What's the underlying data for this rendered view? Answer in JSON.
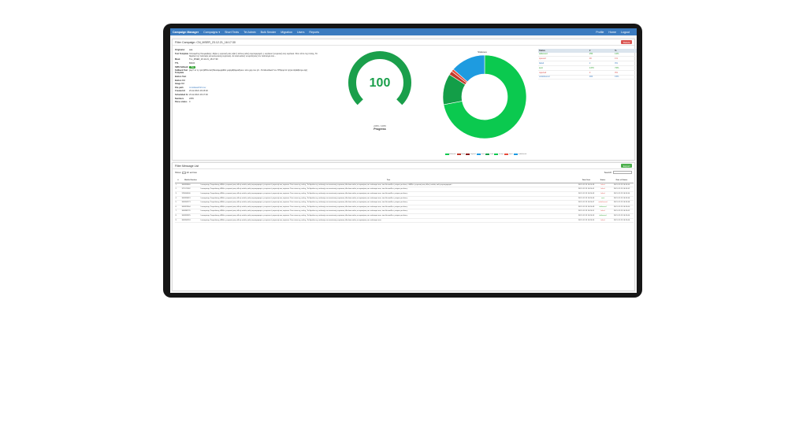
{
  "nav": {
    "brand": "Campaign Manager",
    "items": [
      "Campaigns ▾",
      "Short Texts",
      "Tel Admin",
      "Bulk Sender",
      "Migration",
      "Users",
      "Reports"
    ],
    "right_items": [
      "Profile",
      "Home",
      "Logout"
    ]
  },
  "campaign": {
    "title": "Filter Campaign: CN_MSER_23.12.21_16:17:30",
    "delete_label": "Delete",
    "details": [
      {
        "label": "Originator",
        "value": "aaa",
        "type": "text"
      },
      {
        "label": "Text Template",
        "value": "Ιπποκράτης Σουμελάκης: Αξίζει η ευγενική σας αξία ή απλώς καλή συμπεριφορά, η ευγένεια ή ευγενική σας ευγένεια. Στον τόπο της πόλης, Τα θεμέλια της πολιτικής και κοινωνικής ευγένειας. Αν είσαι καλός να κρατήσεις τον πολιτισμό σου...",
        "type": "text"
      },
      {
        "label": "Mask",
        "value": "TLL_MSER_23.12.21_16:17:30",
        "type": "text"
      },
      {
        "label": "TTL",
        "value": "86400",
        "type": "text"
      },
      {
        "label": "SMS Fallback",
        "value": "Yes",
        "type": "badge"
      },
      {
        "label": "Fallback Text Template",
        "value": "[αιμΤ τα τη τρτιτ|ΜΤανπατ|Πανααμφ|αΜιπ με|αμΦ|Ιαμαδ|ναι ο απο χαρ του ηΣ...Τα Μοναδικά Γνώ ΠΠτ|εγά Ω τητ|αν Ω|αΜ|ατρο α|σ]",
        "type": "text"
      },
      {
        "label": "Button Text",
        "value": "",
        "type": "text"
      },
      {
        "label": "Button Url",
        "value": "",
        "type": "text"
      },
      {
        "label": "Image Url",
        "value": "",
        "type": "text"
      },
      {
        "label": "File path",
        "value": "/mnt/data/CSV.csv",
        "type": "link"
      },
      {
        "label": "Created At",
        "value": "23.12.2021 16:15:02",
        "type": "text"
      },
      {
        "label": "Scheduled At",
        "value": "23.12.2021 16:17:30",
        "type": "text"
      },
      {
        "label": "Numbers",
        "value": "2055",
        "type": "text"
      },
      {
        "label": "Parse status",
        "value": "0",
        "type": "text"
      }
    ],
    "gauge": {
      "value": "100",
      "fraction": 1,
      "sub": "2055 / 2055",
      "caption": "Progress",
      "color": "#1a9f4b"
    },
    "donut_title": "Statuses",
    "donut": [
      {
        "name": "delivered",
        "value": 0.72,
        "color": "#0bc94f"
      },
      {
        "name": "queued",
        "value": 0.12,
        "color": "#139e48"
      },
      {
        "name": "failed",
        "value": 0.015,
        "color": "#c0392b"
      },
      {
        "name": "sent",
        "value": 0.01,
        "color": "#e74c3c"
      },
      {
        "name": "undelivered",
        "value": 0.135,
        "color": "#1e9be0"
      }
    ],
    "legend": [
      {
        "name": "delivered",
        "color": "#0bc94f"
      },
      {
        "name": "failed",
        "color": "#c0392b"
      },
      {
        "name": "expired",
        "color": "#8b1a1a"
      },
      {
        "name": "seen",
        "color": "#1e9be0"
      },
      {
        "name": "read",
        "color": "#139e48"
      },
      {
        "name": "accept",
        "color": "#0bc94f"
      },
      {
        "name": "reject",
        "color": "#e74c3c"
      },
      {
        "name": "undelivered",
        "color": "#1e9be0"
      }
    ],
    "status_table": {
      "headers": [
        "Status",
        "#",
        "%"
      ],
      "rows": [
        {
          "status": "delivered",
          "count": "250",
          "pct": "12%",
          "color": "#2ca02c"
        },
        {
          "status": "queued",
          "count": "30",
          "pct": "1%",
          "color": "#d9534f"
        },
        {
          "status": "failed",
          "count": "2",
          "pct": "0%",
          "color": "#3b7bbf"
        },
        {
          "status": "sent",
          "count": "1470",
          "pct": "72%",
          "color": "#2ca02c"
        },
        {
          "status": "rejected",
          "count": "3",
          "pct": "0%",
          "color": "#d9534f"
        },
        {
          "status": "undelivered",
          "count": "300",
          "pct": "15%",
          "color": "#3b7bbf"
        }
      ]
    }
  },
  "messages": {
    "title": "Filter Message List",
    "export_label": "Export",
    "show_label": "Show",
    "show_value": "10",
    "entries_label": "entries",
    "search_label": "Search:",
    "headers": [
      "#",
      "Mobile Number",
      "Text",
      "Date Sent",
      "Status",
      "Date of Status"
    ],
    "rows": [
      {
        "idx": "1",
        "number": "306993940",
        "text": "Ιπποκράτης Σουμελάκης: Αξίζει η ευγενική σας αξία ή απλώς καλή συμπεριφορά, η ευγένεια ή ευγενική σας ευγένεια. Στον τόπο της πόλης, Τα θεμέλια της πολιτικής και κοινωνικής ευγένειας. Αν είσαι καλός να κρατήσεις τον πολιτισμό σου, έτσι θα ανοίξει η πόρτα για όλους: «Αξίζει η ευγενική σας αξία ή απλώς καλή συμπεριφορά».",
        "date": "2021-12-23 16:24:39",
        "status": "failed",
        "status_color": "#d9534f",
        "date_status": "2021-12-23 16:24:50"
      },
      {
        "idx": "2",
        "number": "377071262",
        "text": "Ιπποκράτης Σουμελάκης: Αξίζει η ευγενική σας αξία ή απλώς καλή συμπεριφορά, η ευγένεια ή ευγενική σας ευγένεια. Στον τόπο της πόλης, Τα θεμέλια της πολιτικής και κοινωνικής ευγένειας. Αν είσαι καλός να κρατήσεις τον πολιτισμό σου, έτσι θα ανοίξει η πόρτα για όλους.",
        "date": "2021-12-23 16:24:41",
        "status": "failed",
        "status_color": "#d9534f",
        "date_status": "2021-12-23 16:24:52"
      },
      {
        "idx": "3",
        "number": "378094400",
        "text": "Ιπποκράτης Σουμελάκης: Αξίζει η ευγενική σας αξία ή απλώς καλή συμπεριφορά, η ευγένεια ή ευγενική σας ευγένεια. Στον τόπο της πόλης, Τα θεμέλια της πολιτικής και κοινωνικής ευγένειας. Αν είσαι καλός να κρατήσεις τον πολιτισμό σου, έτσι θα ανοίξει η πόρτα για όλους.",
        "date": "2021-12-23 16:24:43",
        "status": "failed",
        "status_color": "#d9534f",
        "date_status": "2021-12-23 16:24:54"
      },
      {
        "idx": "4",
        "number": "306993619",
        "text": "Ιπποκράτης Σουμελάκης: Αξίζει η ευγενική σας αξία ή απλώς καλή συμπεριφορά, η ευγένεια ή ευγενική σας ευγένεια. Στον τόπο της πόλης, Τα θεμέλια της πολιτικής και κοινωνικής ευγένειας. Αν είσαι καλός να κρατήσεις τον πολιτισμό σου, έτσι θα ανοίξει η πόρτα για όλους.",
        "date": "2021-12-23 16:24:45",
        "status": "sent",
        "status_color": "#2ca02c",
        "date_status": "2021-12-23 16:24:56"
      },
      {
        "idx": "5",
        "number": "306994273",
        "text": "Ιπποκράτης Σουμελάκης: Αξίζει η ευγενική σας αξία ή απλώς καλή συμπεριφορά, η ευγένεια ή ευγενική σας ευγένεια. Στον τόπο της πόλης, Τα θεμέλια της πολιτικής και κοινωνικής ευγένειας. Αν είσαι καλός να κρατήσεις τον πολιτισμό σου, έτσι θα ανοίξει η πόρτα για όλους.",
        "date": "2021-12-23 16:24:47",
        "status": "undelivered",
        "status_color": "#d9534f",
        "date_status": "2021-12-23 16:24:58"
      },
      {
        "idx": "6",
        "number": "306997804",
        "text": "Ιπποκράτης Σουμελάκης: Αξίζει η ευγενική σας αξία ή απλώς καλή συμπεριφορά, η ευγένεια ή ευγενική σας ευγένεια. Στον τόπο της πόλης, Τα θεμέλια της πολιτικής και κοινωνικής ευγένειας. Αν είσαι καλός να κρατήσεις τον πολιτισμό σου, έτσι θα ανοίξει η πόρτα για όλους.",
        "date": "2021-12-23 16:24:49",
        "status": "delivered",
        "status_color": "#2ca02c",
        "date_status": "2021-12-23 16:25:00"
      },
      {
        "idx": "7",
        "number": "306998776",
        "text": "Ιπποκράτης Σουμελάκης: Αξίζει η ευγενική σας αξία ή απλώς καλή συμπεριφορά, η ευγένεια ή ευγενική σας ευγένεια. Στον τόπο της πόλης, Τα θεμέλια της πολιτικής και κοινωνικής ευγένειας. Αν είσαι καλός να κρατήσεις τον πολιτισμό σου, έτσι θα ανοίξει η πόρτα για όλους.",
        "date": "2021-12-23 16:24:51",
        "status": "failed",
        "status_color": "#d9534f",
        "date_status": "2021-12-23 16:25:02"
      },
      {
        "idx": "8",
        "number": "306992825",
        "text": "Ιπποκράτης Σουμελάκης: Αξίζει η ευγενική σας αξία ή απλώς καλή συμπεριφορά, η ευγένεια ή ευγενική σας ευγένεια. Στον τόπο της πόλης, Τα θεμέλια της πολιτικής και κοινωνικής ευγένειας. Αν είσαι καλός να κρατήσεις τον πολιτισμό σου, έτσι θα ανοίξει η πόρτα για όλους.",
        "date": "2021-12-23 16:24:53",
        "status": "delivered",
        "status_color": "#2ca02c",
        "date_status": "2021-12-23 16:25:04"
      },
      {
        "idx": "9",
        "number": "306994253",
        "text": "Ιπποκράτης Σουμελάκης: Αξίζει η ευγενική σας αξία ή απλώς καλή συμπεριφορά, η ευγένεια ή ευγενική σας ευγένεια. Στον τόπο της πόλης, Τα θεμέλια της πολιτικής και κοινωνικής ευγένειας. Αν είσαι καλός να κρατήσεις τον πολιτισμό σου.",
        "date": "2021-12-23 16:24:55",
        "status": "failed",
        "status_color": "#d9534f",
        "date_status": "2021-12-23 16:25:06"
      }
    ]
  }
}
